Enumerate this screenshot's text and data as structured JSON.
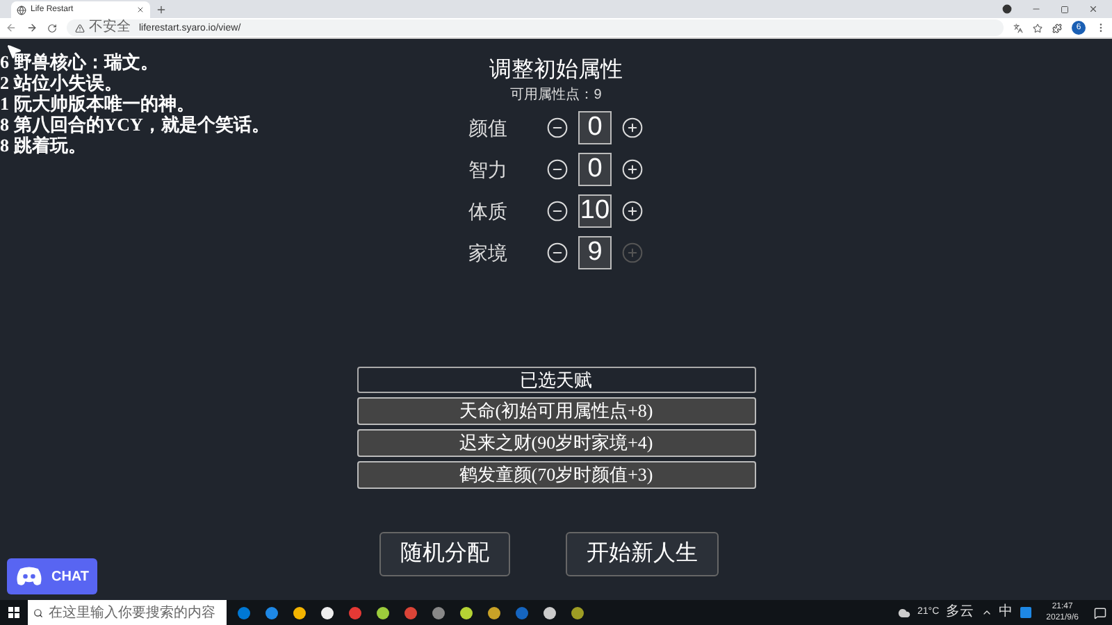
{
  "browser": {
    "tab_title": "Life Restart",
    "security_label": "不安全",
    "url": "liferestart.syaro.io/view/",
    "profile_initial": "6"
  },
  "comments": [
    "6 野兽核心：瑞文。",
    "2 站位小失误。",
    "1 阮大帅版本唯一的神。",
    "8 第八回合的YCY，就是个笑话。",
    "8 跳着玩。"
  ],
  "attributes": {
    "title": "调整初始属性",
    "available": "可用属性点：9",
    "items": [
      {
        "name": "颜值",
        "value": "0",
        "plus_disabled": false
      },
      {
        "name": "智力",
        "value": "0",
        "plus_disabled": false
      },
      {
        "name": "体质",
        "value": "10",
        "plus_disabled": false
      },
      {
        "name": "家境",
        "value": "9",
        "plus_disabled": true
      }
    ]
  },
  "talents": {
    "title": "已选天赋",
    "items": [
      "天命(初始可用属性点+8)",
      "迟来之财(90岁时家境+4)",
      "鹤发童颜(70岁时颜值+3)"
    ]
  },
  "buttons": [
    "随机分配",
    "开始新人生"
  ],
  "chat_button": "CHAT",
  "taskbar": {
    "search_placeholder": "在这里输入你要搜索的内容",
    "weather": "21°C",
    "weather_text": "多云",
    "ime": "中",
    "time": "21:47",
    "date": "2021/9/6"
  }
}
